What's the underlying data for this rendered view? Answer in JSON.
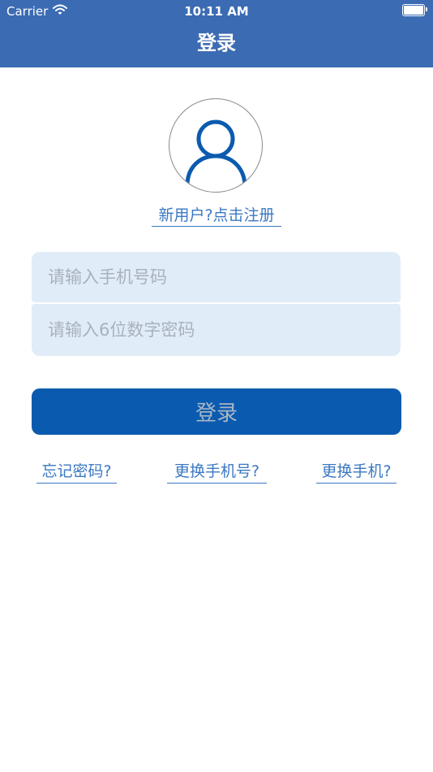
{
  "status_bar": {
    "carrier": "Carrier",
    "time": "10:11 AM",
    "wifi_icon": "wifi-icon",
    "battery_icon": "battery-icon"
  },
  "nav": {
    "title": "登录"
  },
  "avatar": {
    "icon": "user-avatar-icon"
  },
  "register_link": "新用户?点击注册",
  "form": {
    "phone_placeholder": "请输入手机号码",
    "phone_value": "",
    "password_placeholder": "请输入6位数字密码",
    "password_value": "",
    "login_label": "登录"
  },
  "links": {
    "forgot_password": "忘记密码?",
    "change_phone_number": "更换手机号?",
    "change_phone": "更换手机?"
  },
  "colors": {
    "nav_background": "#3b6bb3",
    "input_background": "#e0ecf8",
    "button_background": "#0a5baf",
    "link": "#3b78c4"
  }
}
